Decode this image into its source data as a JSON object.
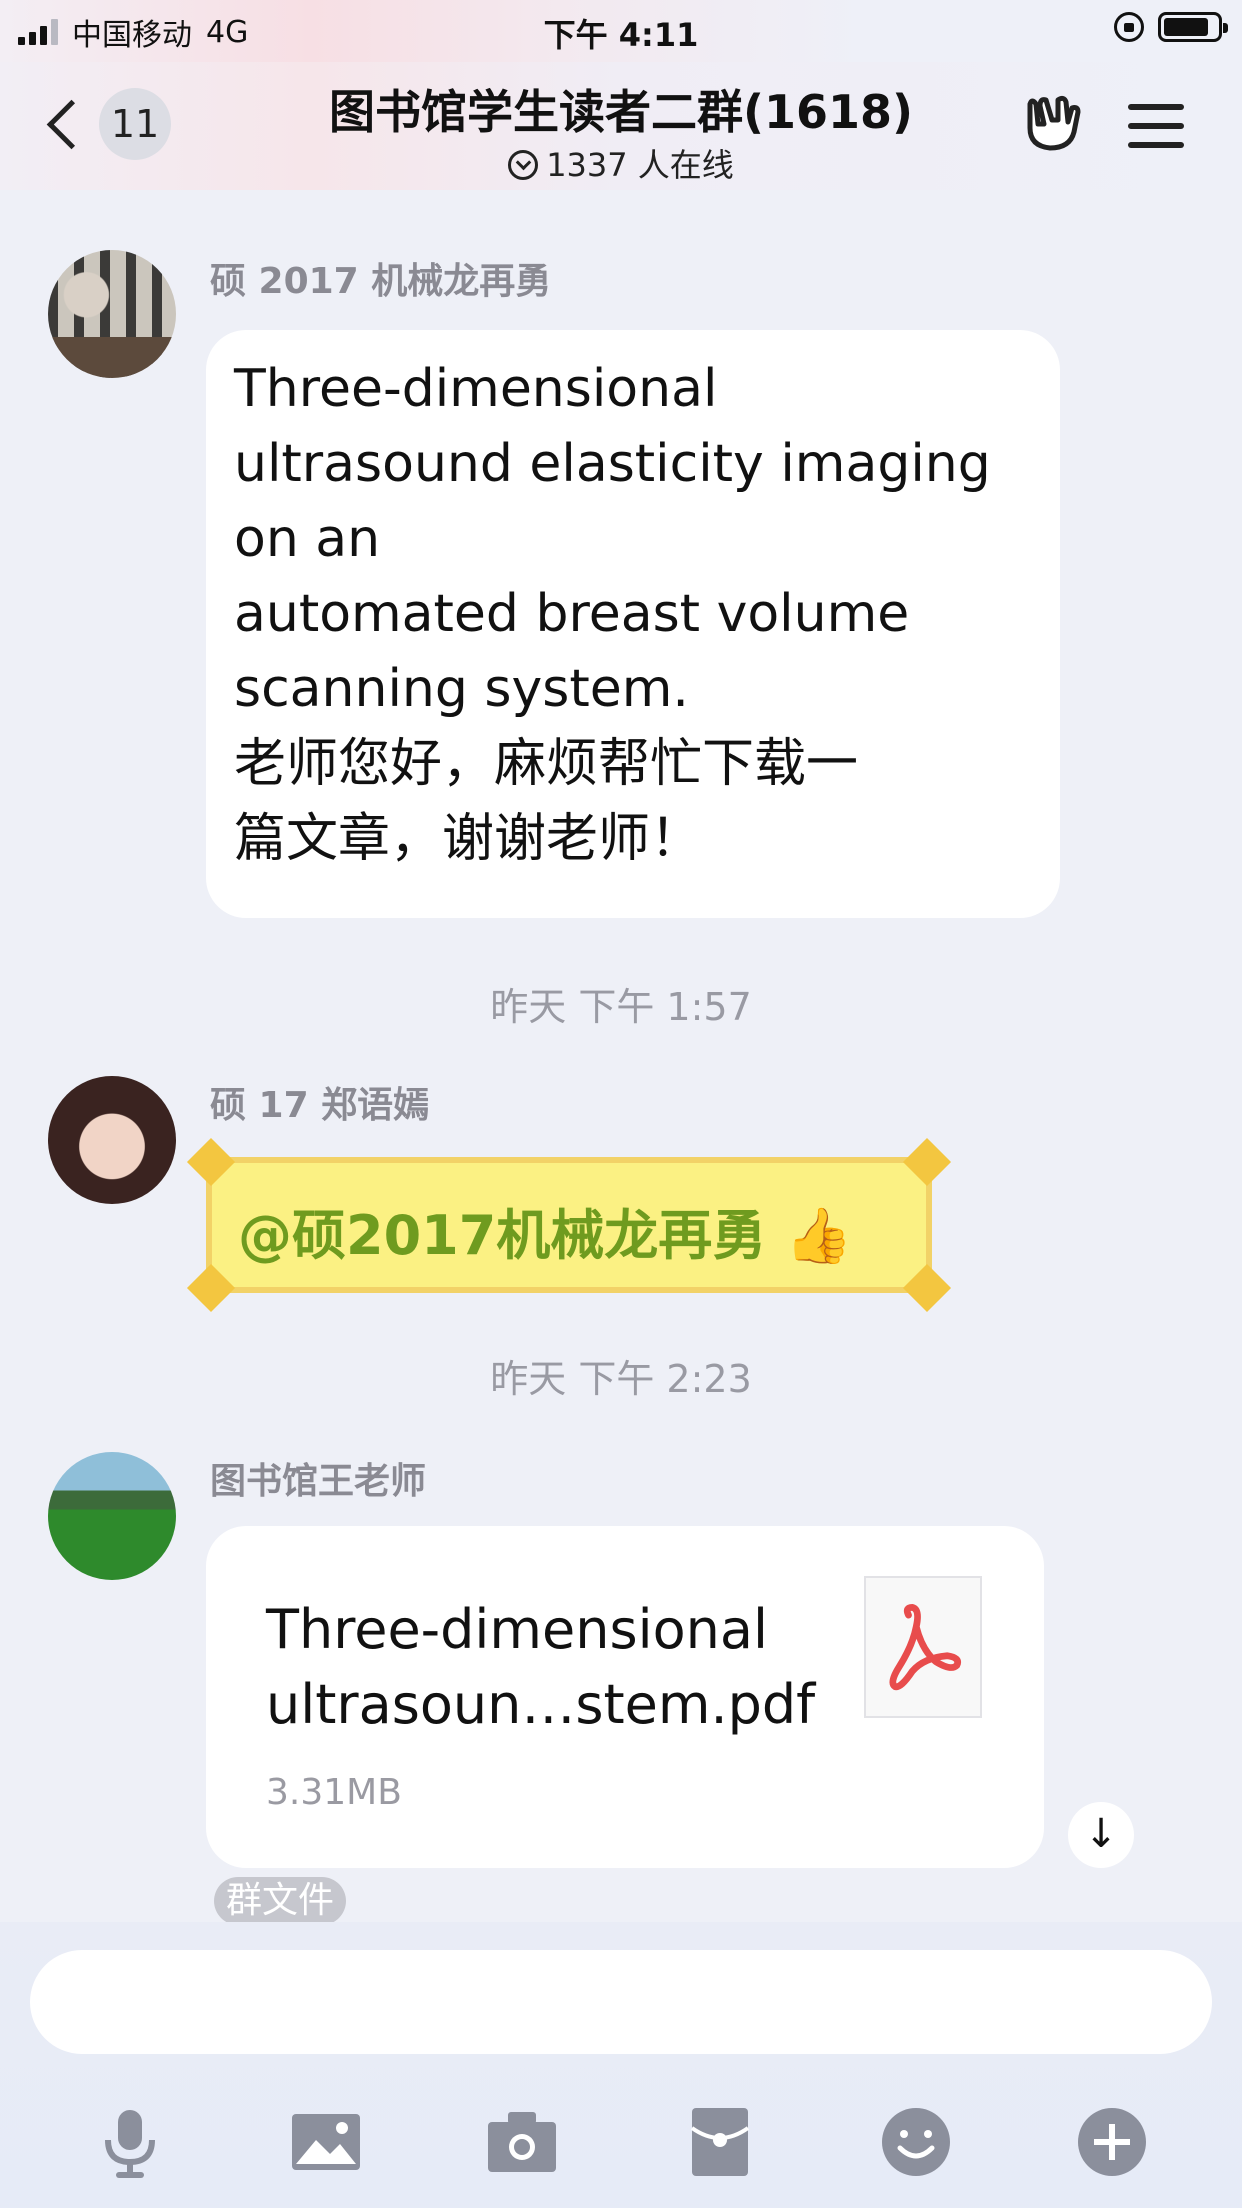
{
  "status_bar": {
    "carrier": "中国移动",
    "network": "4G",
    "time": "下午 4:11"
  },
  "nav": {
    "back_count": "11",
    "title": "图书馆学生读者二群(1618)",
    "online": "1337 人在线"
  },
  "messages": [
    {
      "sender": "硕 2017 机械龙再勇",
      "text": "Three-dimensional\nultrasound elasticity imaging\non an\nautomated breast volume\nscanning system.\n老师您好，麻烦帮忙下载一\n篇文章，谢谢老师！"
    },
    {
      "timestamp": "昨天  下午 1:57"
    },
    {
      "sender": "硕 17 郑语嫣",
      "text": "@硕2017机械龙再勇 👍"
    },
    {
      "timestamp": "昨天  下午 2:23"
    },
    {
      "sender": "图书馆王老师",
      "file_name": "Three-dimensional\nultrasoun…stem.pdf",
      "file_size": "3.31MB",
      "file_tag": "群文件"
    }
  ],
  "icons": {
    "toolbar": [
      "microphone-icon",
      "image-icon",
      "camera-icon",
      "red-packet-icon",
      "emoji-icon",
      "plus-icon"
    ]
  },
  "colors": {
    "background": "#eef0f7",
    "sticker_text": "#6f9b1f",
    "sticker_fill": "#fbf183",
    "pdf_red": "#e84c4c"
  }
}
